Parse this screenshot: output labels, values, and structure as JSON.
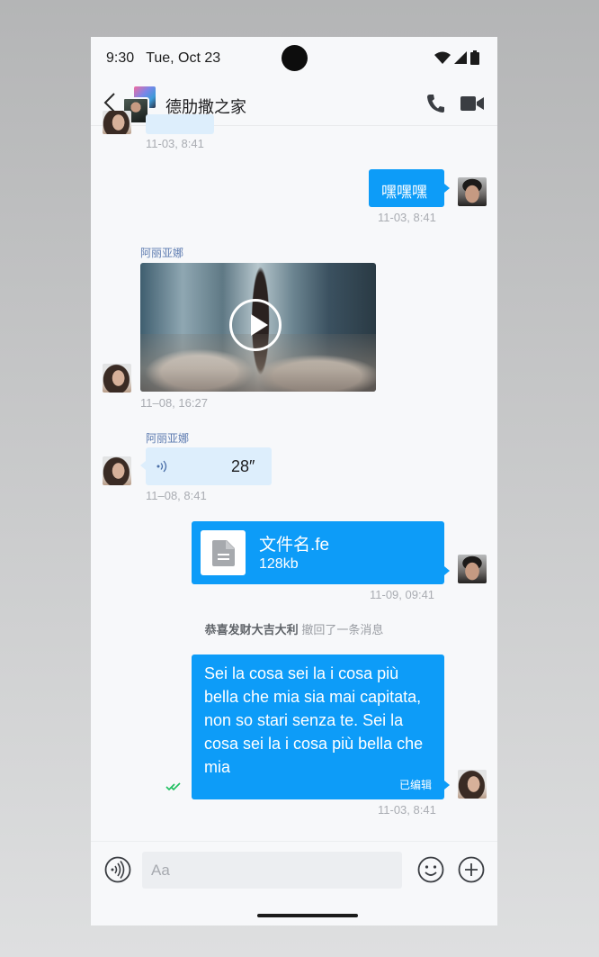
{
  "status": {
    "time": "9:30",
    "date": "Tue, Oct 23"
  },
  "header": {
    "title": "德肋撒之家"
  },
  "messages": {
    "m0": {
      "time": "11-03, 8:41"
    },
    "m1": {
      "text": "嘿嘿嘿",
      "time": "11-03, 8:41"
    },
    "m2": {
      "sender": "阿丽亚娜",
      "time": "11–08, 16:27"
    },
    "m3": {
      "sender": "阿丽亚娜",
      "duration": "28″",
      "time": "11–08, 8:41"
    },
    "m4": {
      "file_name": "文件名.fe",
      "file_size": "128kb",
      "time": "11-09, 09:41"
    },
    "recall": {
      "user": "恭喜发财大吉大利",
      "text": "撤回了一条消息"
    },
    "m5": {
      "text": "Sei la cosa sei la i cosa più bella che mia sia mai capitata, non so stari senza te. Sei la cosa sei la i cosa più bella che mia",
      "edited": "已编辑",
      "time": "11-03, 8:41"
    }
  },
  "input": {
    "placeholder": "Aa"
  },
  "colors": {
    "accent": "#0d9cf8",
    "incoming": "#ddeefc",
    "read_check": "#1fbf5f"
  }
}
